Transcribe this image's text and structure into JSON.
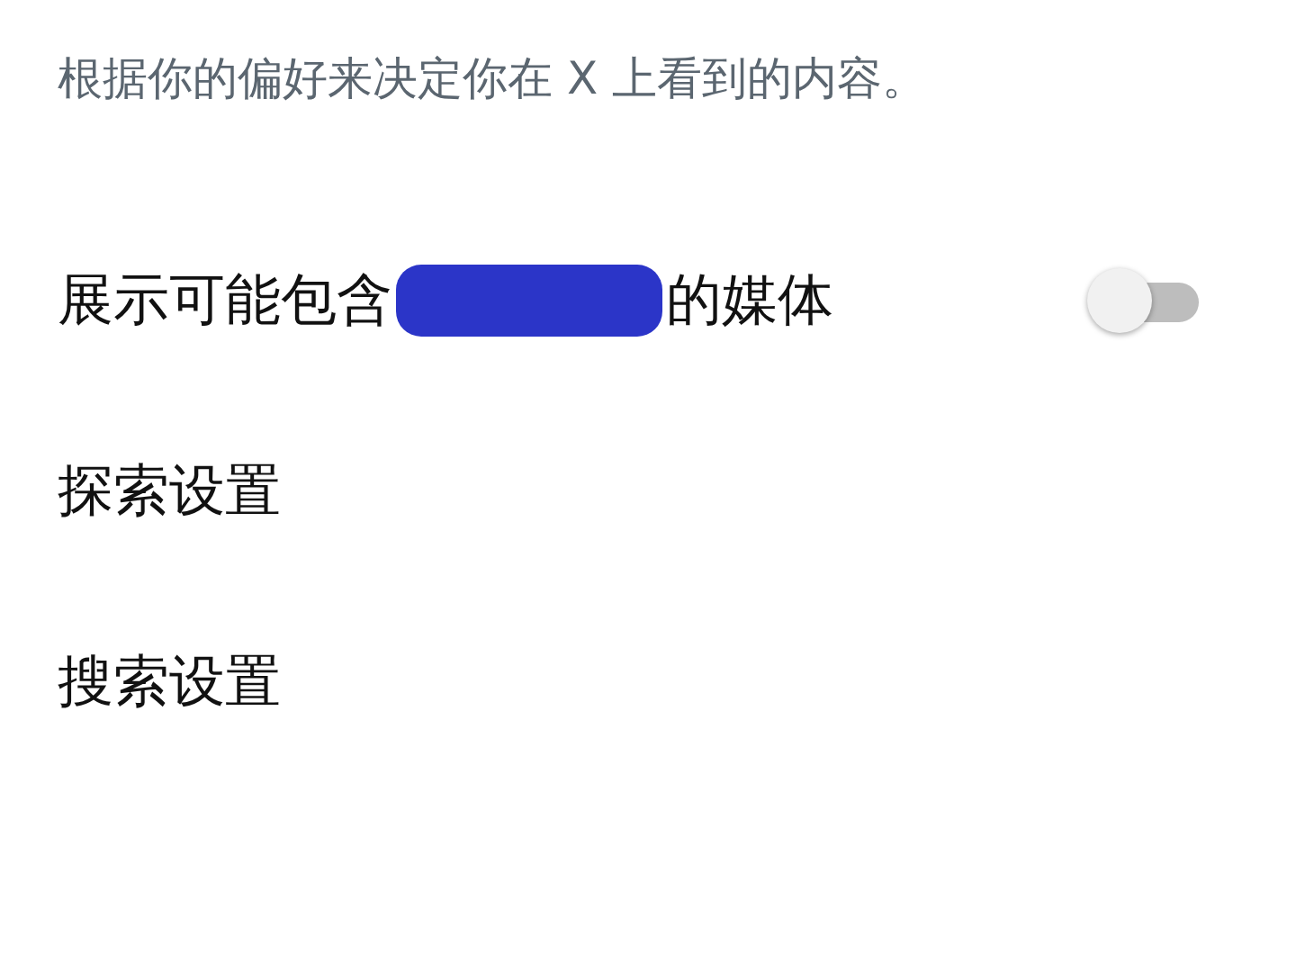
{
  "description": "根据你的偏好来决定你在 X 上看到的内容。",
  "items": [
    {
      "kind": "toggle",
      "label_before": "展示可能包含",
      "redacted": true,
      "label_after": "的媒体",
      "on": false
    },
    {
      "kind": "link",
      "label": "探索设置"
    },
    {
      "kind": "link",
      "label": "搜索设置"
    }
  ]
}
